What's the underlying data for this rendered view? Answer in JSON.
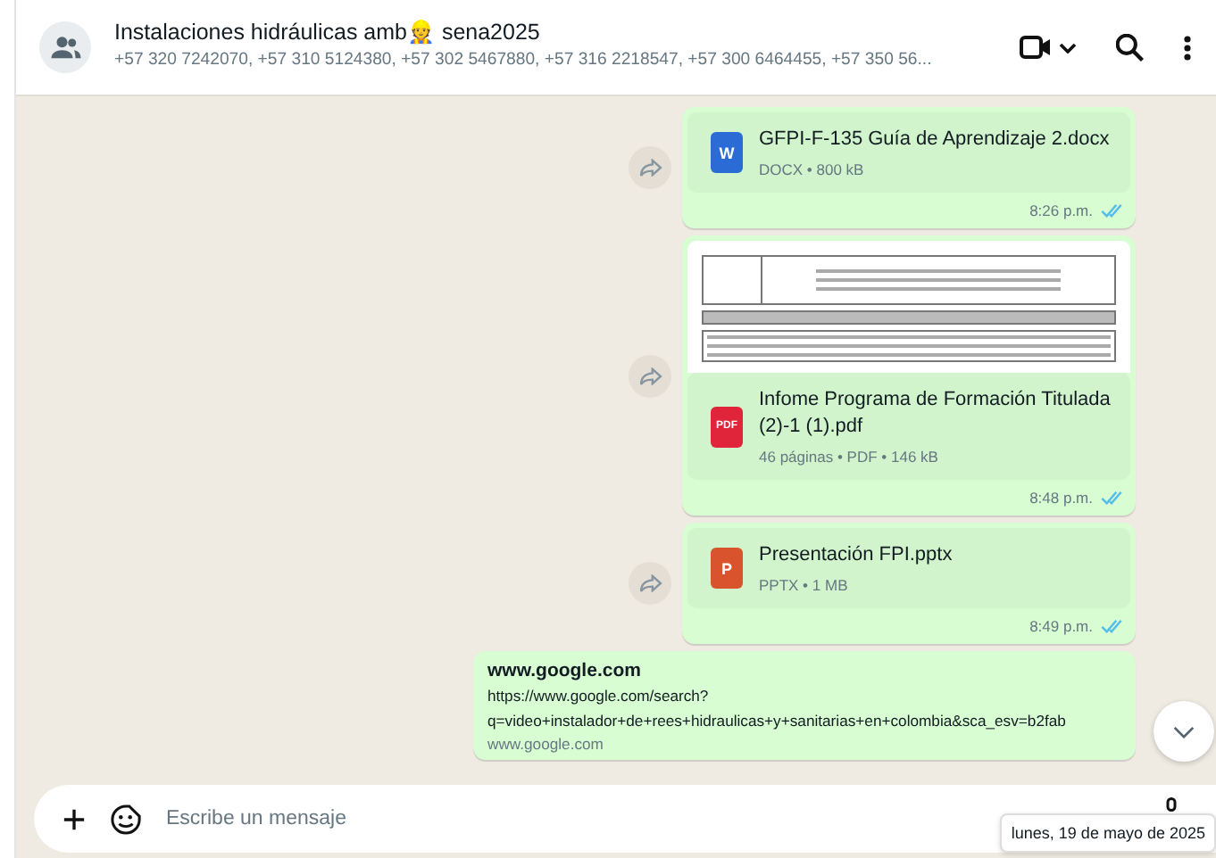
{
  "header": {
    "title": "Instalaciones hidráulicas amb👷 sena2025",
    "subtitle": "+57 320 7242070, +57 310 5124380, +57 302 5467880, +57 316 2218547, +57 300 6464455, +57 350 56..."
  },
  "messages": [
    {
      "kind": "file",
      "color": "#2b6bd6",
      "icon_label": "W",
      "name": "GFPI-F-135 Guía de Aprendizaje 2.docx",
      "meta": "DOCX • 800 kB",
      "time": "8:26 p.m.",
      "read": true,
      "forward": true,
      "preview": false
    },
    {
      "kind": "file",
      "color": "#e0243a",
      "icon_label": "PDF",
      "name": "Infome Programa de Formación Titulada (2)-1 (1).pdf",
      "meta": "46 páginas • PDF • 146 kB",
      "time": "8:48 p.m.",
      "read": true,
      "forward": true,
      "preview": true
    },
    {
      "kind": "file",
      "color": "#d9532c",
      "icon_label": "P",
      "name": "Presentación FPI.pptx",
      "meta": "PPTX • 1 MB",
      "time": "8:49 p.m.",
      "read": true,
      "forward": true,
      "preview": false
    },
    {
      "kind": "link",
      "title": "www.google.com",
      "url_lines": [
        "https://www.google.com/search?",
        "q=video+instalador+de+rees+hidraulicas+y+sanitarias+en+colombia&sca_esv=b2fab"
      ],
      "domain": "www.google.com"
    }
  ],
  "composer": {
    "placeholder": "Escribe un mensaje"
  },
  "date_tooltip": "lunes, 19 de mayo de 2025"
}
